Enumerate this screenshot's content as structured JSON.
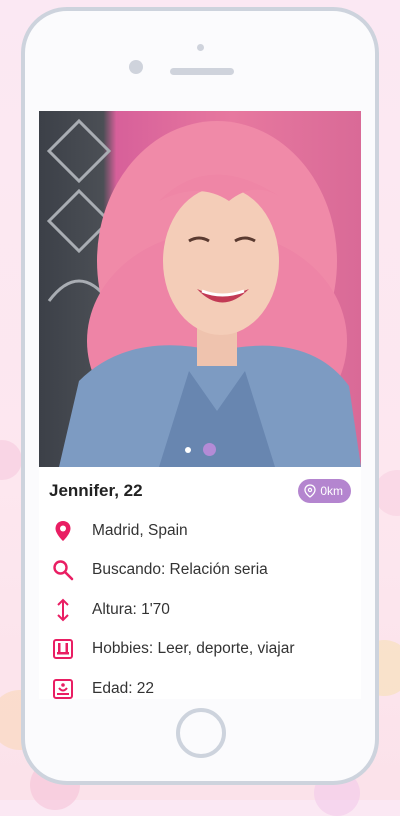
{
  "profile": {
    "name_age": "Jennifer, 22",
    "distance": "0km",
    "photo_index": 2,
    "photo_count": 2
  },
  "details": [
    {
      "icon": "location-pin-icon",
      "text": "Madrid, Spain"
    },
    {
      "icon": "search-icon",
      "text": "Buscando: Relación seria"
    },
    {
      "icon": "height-arrow-icon",
      "text": "Altura: 1'70"
    },
    {
      "icon": "hobbies-icon",
      "text": "Hobbies: Leer, deporte, viajar"
    },
    {
      "icon": "age-icon",
      "text": "Edad: 22"
    }
  ],
  "colors": {
    "accent": "#e91e63",
    "badge": "#b485cf",
    "dot_active": "#b48bd6"
  }
}
